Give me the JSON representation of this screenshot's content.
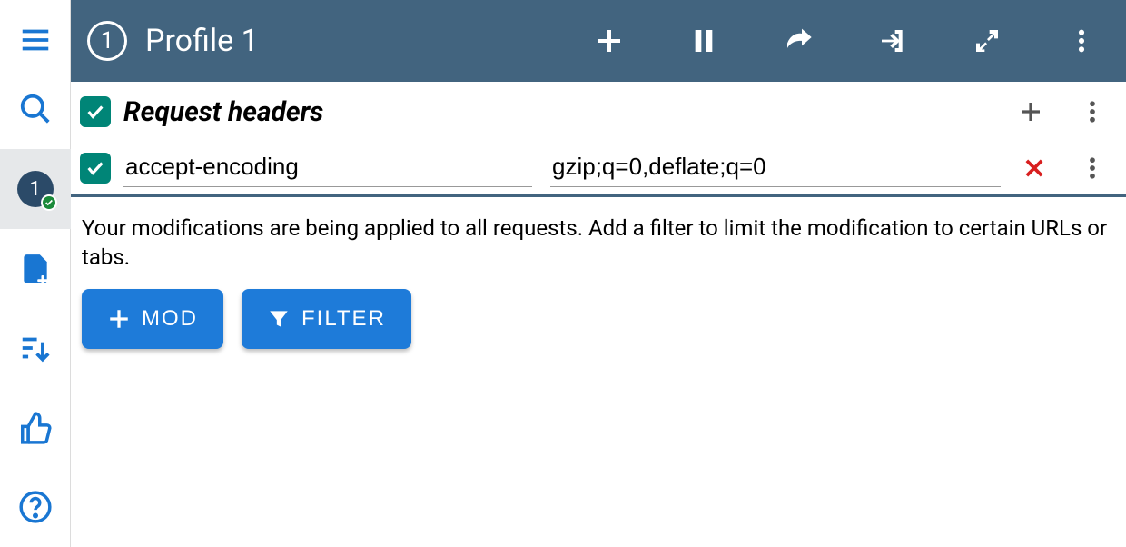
{
  "header": {
    "profile_number": "1",
    "title": "Profile 1"
  },
  "sidebar": {
    "profile_badge": "1"
  },
  "section": {
    "title": "Request headers"
  },
  "headers": [
    {
      "name": "accept-encoding",
      "value": "gzip;q=0,deflate;q=0"
    }
  ],
  "notice": "Your modifications are being applied to all requests. Add a filter to limit the modification to certain URLs or tabs.",
  "buttons": {
    "mod": "MOD",
    "filter": "FILTER"
  }
}
